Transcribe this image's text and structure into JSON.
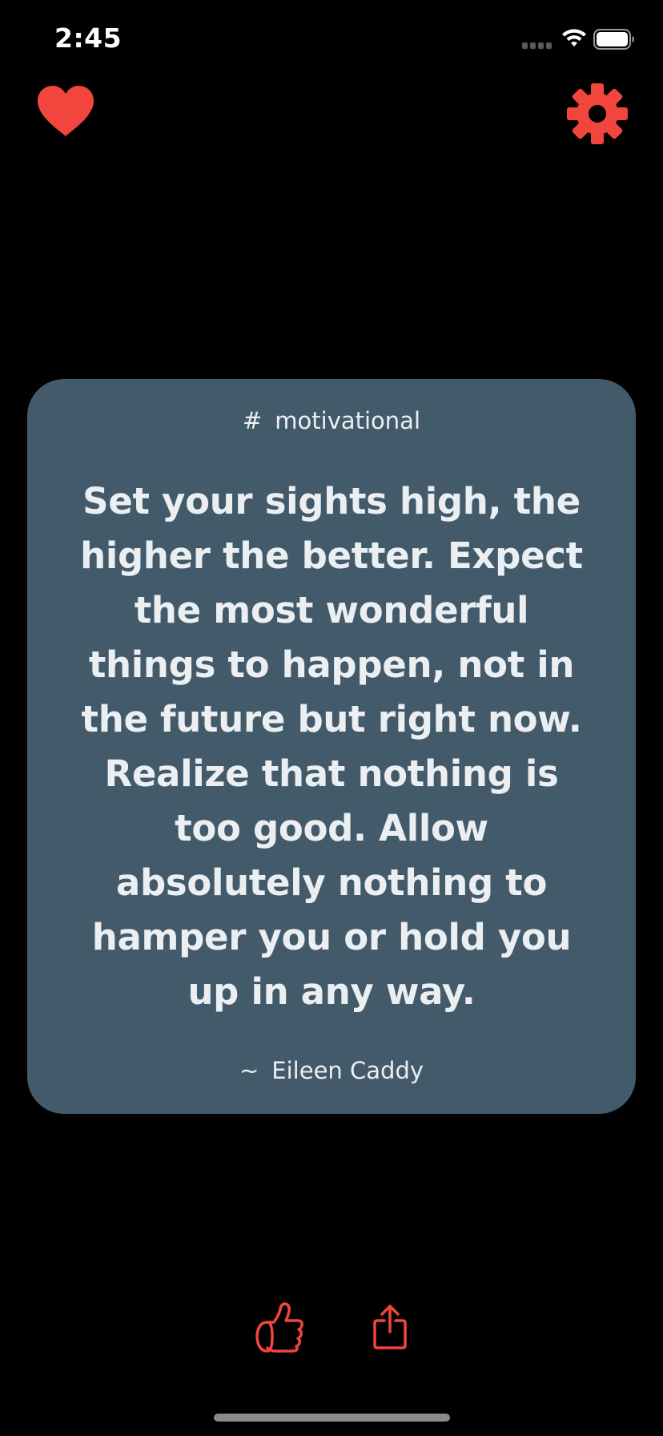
{
  "status_bar": {
    "time": "2:45",
    "signal_icon": "cellular-signal-icon",
    "wifi_icon": "wifi-icon",
    "battery_icon": "battery-icon"
  },
  "top_bar": {
    "favorites_icon": "heart-icon",
    "settings_icon": "gear-icon"
  },
  "quote": {
    "category_symbol": "#",
    "category": "motivational",
    "text": "Set your sights high, the higher the better. Expect the most wonderful things to happen, not in the future but right now. Realize that nothing is too good. Allow absolutely nothing to hamper you or hold you up in any way.",
    "author_symbol": "~",
    "author": "Eileen Caddy"
  },
  "bottom_bar": {
    "like_icon": "thumbs-up-icon",
    "share_icon": "share-icon"
  },
  "colors": {
    "background": "#000000",
    "card": "#435A6B",
    "accent": "#F2453D",
    "text": "#ECEFF1"
  }
}
